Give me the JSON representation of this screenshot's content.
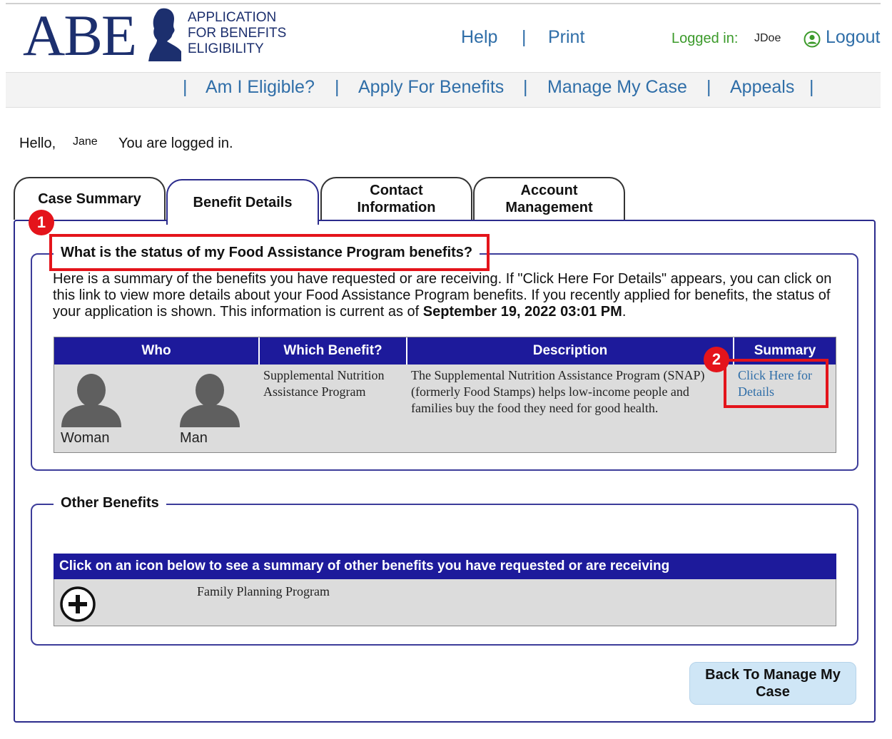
{
  "header": {
    "logo_text": "ABE",
    "logo_sub_line1": "APPLICATION",
    "logo_sub_line2": "FOR BENEFITS",
    "logo_sub_line3": "ELIGIBILITY",
    "help_label": "Help",
    "separator": "|",
    "print_label": "Print",
    "logged_in_label": "Logged in:",
    "logged_in_user": "JDoe",
    "logout_label": "Logout"
  },
  "nav": {
    "separator": "|",
    "items": [
      {
        "label": "Am I Eligible?"
      },
      {
        "label": "Apply For Benefits"
      },
      {
        "label": "Manage My Case"
      },
      {
        "label": "Appeals"
      }
    ]
  },
  "greeting": {
    "hello": "Hello,",
    "name": "Jane",
    "message": "You are logged in."
  },
  "tabs": [
    {
      "label": "Case Summary",
      "active": false
    },
    {
      "label": "Benefit Details",
      "active": true
    },
    {
      "label_line1": "Contact",
      "label_line2": "Information",
      "active": false
    },
    {
      "label_line1": "Account",
      "label_line2": "Management",
      "active": false
    }
  ],
  "food_section": {
    "legend": "What is the status of my Food Assistance Program benefits?",
    "description": "Here is a summary of the benefits you have requested or are receiving. If \"Click Here For Details\" appears, you can click on this link to view more details about your Food Assistance Program benefits. If you recently applied for benefits, the status of your application is shown. This information is current as of ",
    "as_of": "September 19, 2022 03:01 PM",
    "as_of_suffix": ".",
    "table": {
      "headers": [
        "Who",
        "Which Benefit?",
        "Description",
        "Summary"
      ],
      "row": {
        "who": [
          "Woman",
          "Man"
        ],
        "benefit": "Supplemental Nutrition Assistance Program",
        "description": "The Supplemental Nutrition Assistance Program (SNAP) (formerly Food Stamps) helps low-income people and families buy the food they need for good health.",
        "summary_link": "Click Here for Details"
      }
    }
  },
  "other_section": {
    "legend": "Other Benefits",
    "header": "Click on an icon below to see a summary of other benefits you have requested or are receiving",
    "program": "Family Planning Program"
  },
  "back_button_line1": "Back To Manage My",
  "back_button_line2": "Case",
  "annotations": [
    {
      "number": "1"
    },
    {
      "number": "2"
    }
  ],
  "colors": {
    "brand_navy": "#1c2f6e",
    "link_blue": "#2f6ea8",
    "table_header": "#1d1a9b",
    "logged_in_green": "#3b9a2a",
    "annotation_red": "#e4141b",
    "button_blue": "#cfe6f6"
  }
}
